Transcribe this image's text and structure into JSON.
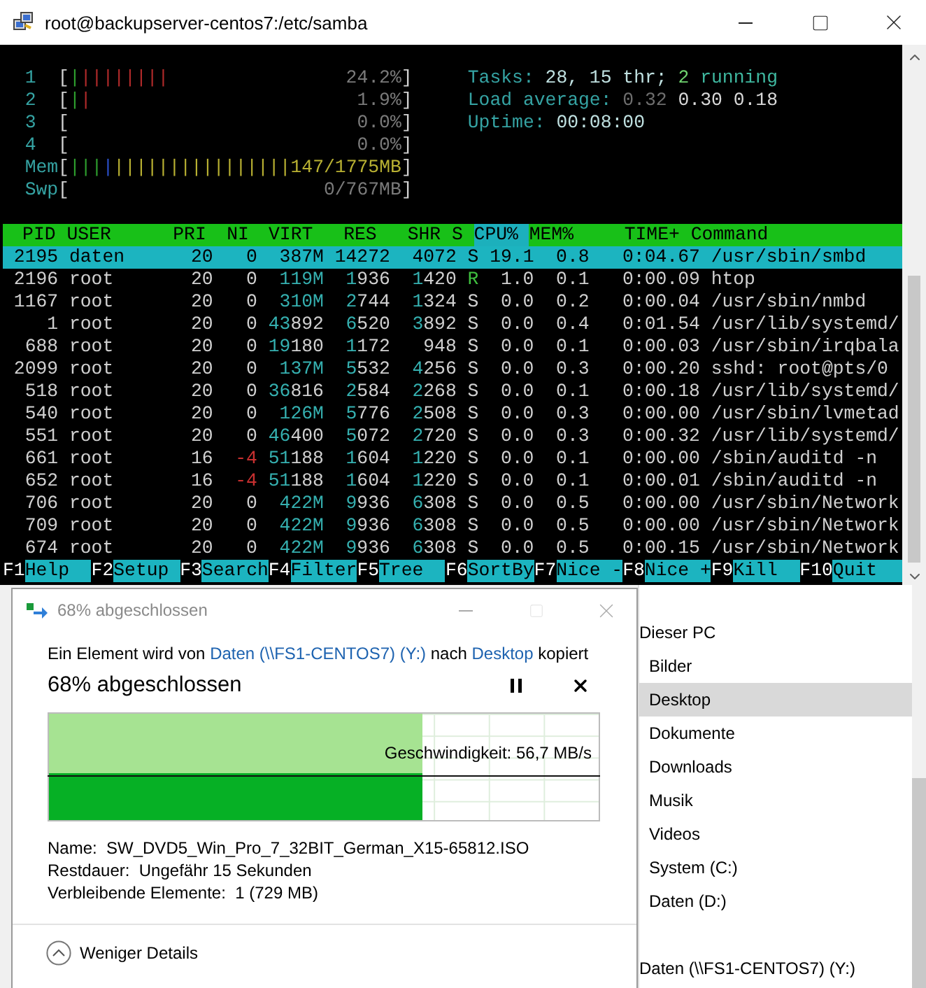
{
  "terminal_window": {
    "title": "root@backupserver-centos7:/etc/samba"
  },
  "meters": [
    {
      "kind": "cpu",
      "label": "1",
      "open": "[",
      "bars": [
        {
          "text": "|",
          "color": "#2e9e2e"
        },
        {
          "text": "||||||||",
          "color": "#b02a2a"
        }
      ],
      "value": "24.2%",
      "close": "]"
    },
    {
      "kind": "cpu",
      "label": "2",
      "open": "[",
      "bars": [
        {
          "text": "|",
          "color": "#2e9e2e"
        },
        {
          "text": "|",
          "color": "#b02a2a"
        }
      ],
      "value": "1.9%",
      "close": "]"
    },
    {
      "kind": "cpu",
      "label": "3",
      "open": "[",
      "value": "0.0%",
      "close": "]"
    },
    {
      "kind": "cpu",
      "label": "4",
      "open": "[",
      "value": "0.0%",
      "close": "]"
    },
    {
      "kind": "memory",
      "label": "Mem",
      "open": "[",
      "bars": [
        {
          "text": "|||",
          "color": "#2e9e2e"
        },
        {
          "text": "|",
          "color": "#2a4fc8"
        },
        {
          "text": "||||||||||||||||",
          "color": "#b8b032"
        }
      ],
      "value": "147/1775MB",
      "close": "]"
    },
    {
      "kind": "swap",
      "label": "Swp",
      "open": "[",
      "value": "0/767MB",
      "close": "]"
    }
  ],
  "info_lines": [
    [
      {
        "text": "Tasks: ",
        "color": "#35a3a3"
      },
      {
        "text": "28, 15 thr; ",
        "color": "#bfe0e0"
      },
      {
        "text": "2",
        "color": "#6fd36f"
      },
      {
        "text": " running",
        "color": "#3fb8a0"
      }
    ],
    [
      {
        "text": "Load average: ",
        "color": "#35a3a3"
      },
      {
        "text": "0.32 ",
        "color": "#6e6e6e"
      },
      {
        "text": "0.30 ",
        "color": "#d8d8d8"
      },
      {
        "text": "0.18",
        "color": "#d8d8d8"
      }
    ],
    [
      {
        "text": "Uptime: ",
        "color": "#35a3a3"
      },
      {
        "text": "00:08:00",
        "color": "#bfe0e0"
      }
    ]
  ],
  "processes": {
    "columns": [
      {
        "label": "PID",
        "sorted": false
      },
      {
        "label": "USER",
        "sorted": false
      },
      {
        "label": "PRI",
        "sorted": false
      },
      {
        "label": "NI",
        "sorted": false
      },
      {
        "label": "VIRT",
        "sorted": false
      },
      {
        "label": "RES",
        "sorted": false
      },
      {
        "label": "SHR",
        "sorted": false
      },
      {
        "label": "S",
        "sorted": false
      },
      {
        "label": "CPU%",
        "sorted": true
      },
      {
        "label": "MEM%",
        "sorted": false
      },
      {
        "label": "TIME+",
        "sorted": false
      },
      {
        "label": "Command",
        "sorted": false
      }
    ],
    "rows": [
      {
        "selected": true,
        "cells": [
          "2195",
          "daten",
          "20",
          "0",
          "387M",
          "14272",
          "4072",
          "S",
          "19.1",
          "0.8",
          "0:04.67",
          "/usr/sbin/smbd"
        ]
      },
      {
        "selected": false,
        "cells": [
          "2196",
          "root",
          "20",
          "0",
          "119M",
          "1936",
          "1420",
          "R",
          "1.0",
          "0.1",
          "0:00.09",
          "htop"
        ]
      },
      {
        "selected": false,
        "cells": [
          "1167",
          "root",
          "20",
          "0",
          "310M",
          "2744",
          "1324",
          "S",
          "0.0",
          "0.2",
          "0:00.04",
          "/usr/sbin/nmbd"
        ]
      },
      {
        "selected": false,
        "cells": [
          "1",
          "root",
          "20",
          "0",
          "43892",
          "6520",
          "3892",
          "S",
          "0.0",
          "0.4",
          "0:01.54",
          "/usr/lib/systemd/"
        ]
      },
      {
        "selected": false,
        "cells": [
          "688",
          "root",
          "20",
          "0",
          "19180",
          "1172",
          "948",
          "S",
          "0.0",
          "0.1",
          "0:00.03",
          "/usr/sbin/irqbala"
        ]
      },
      {
        "selected": false,
        "cells": [
          "2099",
          "root",
          "20",
          "0",
          "137M",
          "5532",
          "4256",
          "S",
          "0.0",
          "0.3",
          "0:00.20",
          "sshd: root@pts/0"
        ]
      },
      {
        "selected": false,
        "cells": [
          "518",
          "root",
          "20",
          "0",
          "36816",
          "2584",
          "2268",
          "S",
          "0.0",
          "0.1",
          "0:00.18",
          "/usr/lib/systemd/"
        ]
      },
      {
        "selected": false,
        "cells": [
          "540",
          "root",
          "20",
          "0",
          "126M",
          "5776",
          "2508",
          "S",
          "0.0",
          "0.3",
          "0:00.00",
          "/usr/sbin/lvmetad"
        ]
      },
      {
        "selected": false,
        "cells": [
          "551",
          "root",
          "20",
          "0",
          "46400",
          "5072",
          "2720",
          "S",
          "0.0",
          "0.3",
          "0:00.32",
          "/usr/lib/systemd/"
        ]
      },
      {
        "selected": false,
        "cells": [
          "661",
          "root",
          "16",
          "-4",
          "51188",
          "1604",
          "1220",
          "S",
          "0.0",
          "0.1",
          "0:00.00",
          "/sbin/auditd -n"
        ]
      },
      {
        "selected": false,
        "cells": [
          "652",
          "root",
          "16",
          "-4",
          "51188",
          "1604",
          "1220",
          "S",
          "0.0",
          "0.1",
          "0:00.01",
          "/sbin/auditd -n"
        ]
      },
      {
        "selected": false,
        "cells": [
          "706",
          "root",
          "20",
          "0",
          "422M",
          "9936",
          "6308",
          "S",
          "0.0",
          "0.5",
          "0:00.00",
          "/usr/sbin/Network"
        ]
      },
      {
        "selected": false,
        "cells": [
          "709",
          "root",
          "20",
          "0",
          "422M",
          "9936",
          "6308",
          "S",
          "0.0",
          "0.5",
          "0:00.00",
          "/usr/sbin/Network"
        ]
      },
      {
        "selected": false,
        "cells": [
          "674",
          "root",
          "20",
          "0",
          "422M",
          "9936",
          "6308",
          "S",
          "0.0",
          "0.5",
          "0:00.15",
          "/usr/sbin/Network"
        ]
      }
    ]
  },
  "function_keys": [
    {
      "key": "F1",
      "label": "Help"
    },
    {
      "key": "F2",
      "label": "Setup"
    },
    {
      "key": "F3",
      "label": "Search"
    },
    {
      "key": "F4",
      "label": "Filter"
    },
    {
      "key": "F5",
      "label": "Tree"
    },
    {
      "key": "F6",
      "label": "SortBy"
    },
    {
      "key": "F7",
      "label": "Nice -"
    },
    {
      "key": "F8",
      "label": "Nice +"
    },
    {
      "key": "F9",
      "label": "Kill"
    },
    {
      "key": "F10",
      "label": "Quit"
    }
  ],
  "copy_dialog": {
    "title": "68% abgeschlossen",
    "message": [
      {
        "text": "Ein Element wird von ",
        "link": false
      },
      {
        "text": "Daten (\\\\FS1-CENTOS7) (Y:)",
        "link": true
      },
      {
        "text": " nach ",
        "link": false
      },
      {
        "text": "Desktop",
        "link": true
      },
      {
        "text": " kopiert",
        "link": false
      }
    ],
    "heading": "68% abgeschlossen",
    "progress": {
      "level": 0.68,
      "speed": "Geschwindigkeit: 56,7 MB/s"
    },
    "details": [
      {
        "label": "Name:",
        "value": "SW_DVD5_Win_Pro_7_32BIT_German_X15-65812.ISO"
      },
      {
        "label": "Restdauer:",
        "value": "Ungefähr 15 Sekunden"
      },
      {
        "label": "Verbleibende Elemente:",
        "value": "1 (729 MB)"
      }
    ],
    "toggle": "Weniger Details"
  },
  "navigation": {
    "items": [
      {
        "label": "Dieser PC",
        "selected": false,
        "children": [
          {
            "label": "Bilder",
            "selected": false
          },
          {
            "label": "Desktop",
            "selected": true
          },
          {
            "label": "Dokumente",
            "selected": false
          },
          {
            "label": "Downloads",
            "selected": false
          },
          {
            "label": "Musik",
            "selected": false
          },
          {
            "label": "Videos",
            "selected": false
          },
          {
            "label": "System (C:)",
            "selected": false
          },
          {
            "label": "Daten (D:)",
            "selected": false
          }
        ]
      },
      {
        "label": "Daten (\\\\FS1-CENTOS7) (Y:)",
        "selected": false
      }
    ]
  }
}
